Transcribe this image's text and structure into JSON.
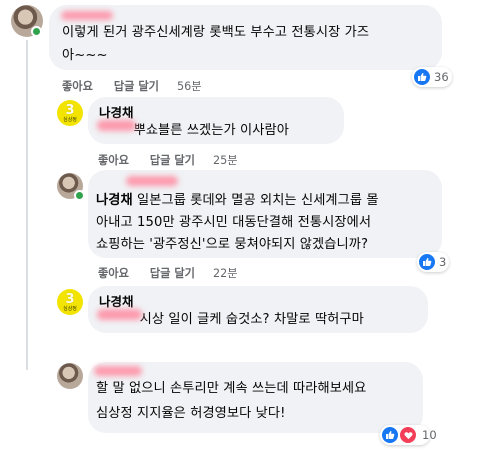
{
  "comments": [
    {
      "author": "",
      "text_lines": [
        "이렇게 된거 광주신세계랑 롯백도 부수고 전통시장 가즈",
        "아~~~"
      ],
      "actions": {
        "like": "좋아요",
        "reply": "답글 달기",
        "time": "56분"
      },
      "reaction": {
        "type": "like",
        "count": "36"
      },
      "avatar": "profile-photo"
    },
    {
      "author": "나경채",
      "text_lines": [
        "  뿌쇼블른 쓰겠는가 이사람아"
      ],
      "actions": {
        "like": "좋아요",
        "reply": "답글 달기",
        "time": "25분"
      },
      "avatar": "party-logo",
      "logo_num": "3",
      "logo_text": "심상정"
    },
    {
      "author": "나경채",
      "text_lines": [
        "일본그룹 롯데와 멸공 외치는 신세계그룹 몰",
        "아내고 150만 광주시민 대동단결해 전통시장에서",
        "쇼핑하는 '광주정신'으로 뭉쳐야되지 않겠습니까?"
      ],
      "actions": {
        "like": "좋아요",
        "reply": "답글 달기",
        "time": "22분"
      },
      "reaction": {
        "type": "like",
        "count": "3"
      },
      "avatar": "profile-photo"
    },
    {
      "author": "나경채",
      "text_lines": [
        "  시상 일이 글케 숩것소? 차말로 딱허구마"
      ],
      "actions": {
        "like": "좋아요",
        "reply": "답글 달기",
        "time": "20분"
      },
      "avatar": "party-logo",
      "logo_num": "3",
      "logo_text": "심상정"
    },
    {
      "author": "",
      "text_lines": [
        "할 말 없으니 손투리만 계속 쓰는데 따라해보세요",
        "심상정 지지율은 허경영보다 낮다!"
      ],
      "reaction": {
        "type": "like-love",
        "count": "10"
      },
      "avatar": "profile-photo"
    }
  ],
  "colors": {
    "bubble": "#f0f2f5",
    "text": "#050505",
    "secondary": "#65676b",
    "like_blue": "#1877f2",
    "love_red": "#f33e58",
    "online_green": "#31a24c",
    "logo_yellow": "#f2e400"
  }
}
